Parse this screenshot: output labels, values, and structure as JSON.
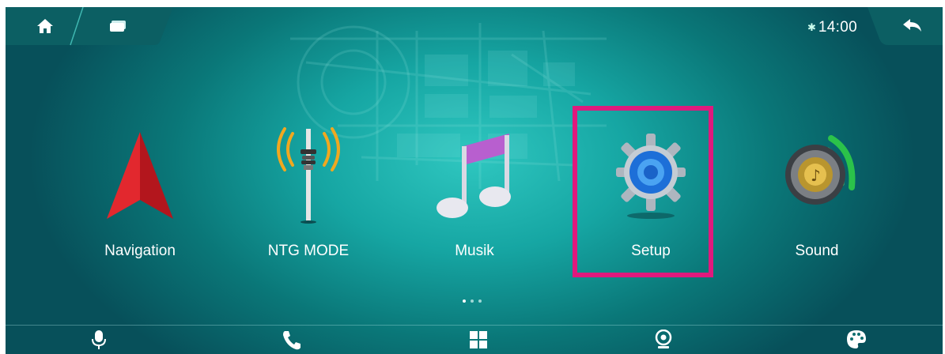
{
  "status_bar": {
    "bluetooth_icon": "bluetooth-icon",
    "time": "14:00"
  },
  "top_nav": {
    "home_icon": "home-icon",
    "recent_icon": "recent-apps-icon",
    "back_icon": "back-arrow-icon"
  },
  "apps": [
    {
      "label": "Navigation",
      "icon": "navigation-arrow-icon"
    },
    {
      "label": "NTG MODE",
      "icon": "antenna-tower-icon"
    },
    {
      "label": "Musik",
      "icon": "music-note-icon"
    },
    {
      "label": "Setup",
      "icon": "gear-icon",
      "highlighted": true
    },
    {
      "label": "Sound",
      "icon": "speaker-icon"
    }
  ],
  "pager": {
    "pages": 3,
    "current": 1
  },
  "dock": [
    {
      "icon": "microphone-icon"
    },
    {
      "icon": "phone-icon"
    },
    {
      "icon": "apps-grid-icon"
    },
    {
      "icon": "camera-icon"
    },
    {
      "icon": "palette-icon"
    }
  ],
  "colors": {
    "background": "#14a3a0",
    "highlight": "#e0197d",
    "text": "#ffffff"
  }
}
